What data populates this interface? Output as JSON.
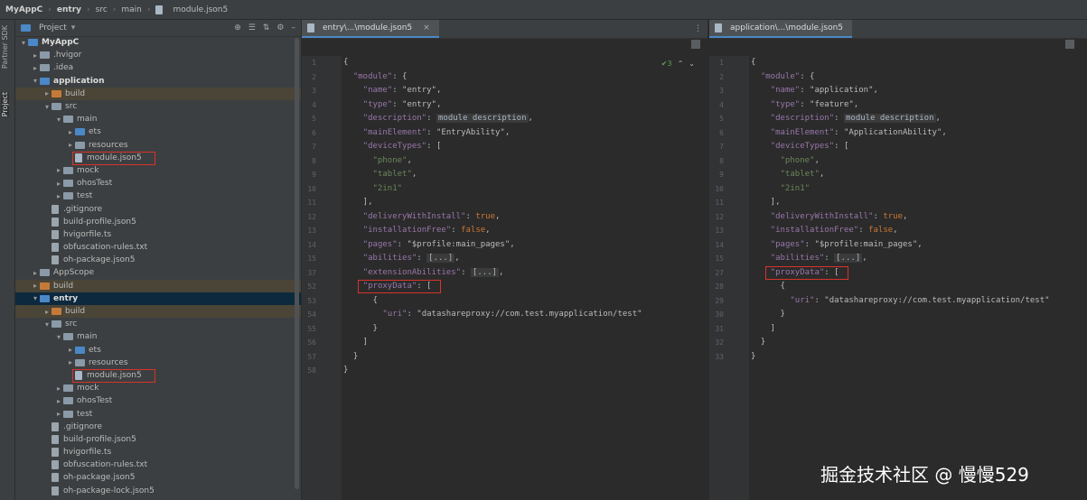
{
  "breadcrumb": [
    "MyAppC",
    "entry",
    "src",
    "main",
    "module.json5"
  ],
  "side_tools": [
    "Partner SDK",
    "Project"
  ],
  "project_panel": {
    "title": "Project"
  },
  "tree": [
    {
      "label": "MyAppC",
      "depth": 0,
      "type": "folder-blue",
      "expanded": true,
      "bold": true
    },
    {
      "label": ".hvigor",
      "depth": 1,
      "type": "folder",
      "collapsed": true
    },
    {
      "label": ".idea",
      "depth": 1,
      "type": "folder",
      "collapsed": true
    },
    {
      "label": "application",
      "depth": 1,
      "type": "folder-blue",
      "expanded": true,
      "bold": true
    },
    {
      "label": "build",
      "depth": 2,
      "type": "folder-orange",
      "collapsed": true,
      "hl": "yellow"
    },
    {
      "label": "src",
      "depth": 2,
      "type": "folder",
      "expanded": true
    },
    {
      "label": "main",
      "depth": 3,
      "type": "folder",
      "expanded": true
    },
    {
      "label": "ets",
      "depth": 4,
      "type": "folder-blue",
      "collapsed": true
    },
    {
      "label": "resources",
      "depth": 4,
      "type": "folder",
      "collapsed": true
    },
    {
      "label": "module.json5",
      "depth": 4,
      "type": "json",
      "boxed": true
    },
    {
      "label": "mock",
      "depth": 3,
      "type": "folder",
      "collapsed": true
    },
    {
      "label": "ohosTest",
      "depth": 3,
      "type": "folder",
      "collapsed": true
    },
    {
      "label": "test",
      "depth": 3,
      "type": "folder",
      "collapsed": true
    },
    {
      "label": ".gitignore",
      "depth": 2,
      "type": "file"
    },
    {
      "label": "build-profile.json5",
      "depth": 2,
      "type": "file"
    },
    {
      "label": "hvigorfile.ts",
      "depth": 2,
      "type": "file"
    },
    {
      "label": "obfuscation-rules.txt",
      "depth": 2,
      "type": "file"
    },
    {
      "label": "oh-package.json5",
      "depth": 2,
      "type": "file"
    },
    {
      "label": "AppScope",
      "depth": 1,
      "type": "folder",
      "collapsed": true
    },
    {
      "label": "build",
      "depth": 1,
      "type": "folder-orange",
      "collapsed": true,
      "hl": "yellow"
    },
    {
      "label": "entry",
      "depth": 1,
      "type": "folder-blue",
      "expanded": true,
      "bold": true,
      "hl": "blue"
    },
    {
      "label": "build",
      "depth": 2,
      "type": "folder-orange",
      "collapsed": true,
      "hl": "yellow"
    },
    {
      "label": "src",
      "depth": 2,
      "type": "folder",
      "expanded": true
    },
    {
      "label": "main",
      "depth": 3,
      "type": "folder",
      "expanded": true
    },
    {
      "label": "ets",
      "depth": 4,
      "type": "folder-blue",
      "collapsed": true
    },
    {
      "label": "resources",
      "depth": 4,
      "type": "folder",
      "collapsed": true
    },
    {
      "label": "module.json5",
      "depth": 4,
      "type": "json",
      "boxed": true
    },
    {
      "label": "mock",
      "depth": 3,
      "type": "folder",
      "collapsed": true
    },
    {
      "label": "ohosTest",
      "depth": 3,
      "type": "folder",
      "collapsed": true
    },
    {
      "label": "test",
      "depth": 3,
      "type": "folder",
      "collapsed": true
    },
    {
      "label": ".gitignore",
      "depth": 2,
      "type": "file"
    },
    {
      "label": "build-profile.json5",
      "depth": 2,
      "type": "file"
    },
    {
      "label": "hvigorfile.ts",
      "depth": 2,
      "type": "file"
    },
    {
      "label": "obfuscation-rules.txt",
      "depth": 2,
      "type": "file"
    },
    {
      "label": "oh-package.json5",
      "depth": 2,
      "type": "file"
    },
    {
      "label": "oh-package-lock.json5",
      "depth": 2,
      "type": "file"
    }
  ],
  "left_editor": {
    "tab": "entry\\...\\module.json5",
    "status": "✔3",
    "lines": [
      {
        "n": "1",
        "t": "{"
      },
      {
        "n": "2",
        "t": "  \"module\": {"
      },
      {
        "n": "3",
        "t": "    \"name\": \"entry\","
      },
      {
        "n": "4",
        "t": "    \"type\": \"entry\","
      },
      {
        "n": "5",
        "t": "    \"description\": module description,"
      },
      {
        "n": "6",
        "t": "    \"mainElement\": \"EntryAbility\","
      },
      {
        "n": "7",
        "t": "    \"deviceTypes\": ["
      },
      {
        "n": "8",
        "t": "      \"phone\","
      },
      {
        "n": "9",
        "t": "      \"tablet\","
      },
      {
        "n": "10",
        "t": "      \"2in1\""
      },
      {
        "n": "11",
        "t": "    ],"
      },
      {
        "n": "12",
        "t": "    \"deliveryWithInstall\": true,"
      },
      {
        "n": "13",
        "t": "    \"installationFree\": false,"
      },
      {
        "n": "14",
        "t": "    \"pages\": \"$profile:main_pages\","
      },
      {
        "n": "15",
        "t": "    \"abilities\": [...],"
      },
      {
        "n": "37",
        "t": "    \"extensionAbilities\": [...],"
      },
      {
        "n": "52",
        "t": "    \"proxyData\": ["
      },
      {
        "n": "53",
        "t": "      {"
      },
      {
        "n": "54",
        "t": "        \"uri\": \"datashareproxy://com.test.myapplication/test\""
      },
      {
        "n": "55",
        "t": "      }"
      },
      {
        "n": "56",
        "t": "    ]"
      },
      {
        "n": "57",
        "t": "  }"
      },
      {
        "n": "58",
        "t": "}"
      }
    ]
  },
  "right_editor": {
    "tab": "application\\...\\module.json5",
    "lines": [
      {
        "n": "1",
        "t": "{"
      },
      {
        "n": "2",
        "t": "  \"module\": {"
      },
      {
        "n": "3",
        "t": "    \"name\": \"application\","
      },
      {
        "n": "4",
        "t": "    \"type\": \"feature\","
      },
      {
        "n": "5",
        "t": "    \"description\": module description,"
      },
      {
        "n": "6",
        "t": "    \"mainElement\": \"ApplicationAbility\","
      },
      {
        "n": "7",
        "t": "    \"deviceTypes\": ["
      },
      {
        "n": "8",
        "t": "      \"phone\","
      },
      {
        "n": "9",
        "t": "      \"tablet\","
      },
      {
        "n": "10",
        "t": "      \"2in1\""
      },
      {
        "n": "11",
        "t": "    ],"
      },
      {
        "n": "12",
        "t": "    \"deliveryWithInstall\": true,"
      },
      {
        "n": "13",
        "t": "    \"installationFree\": false,"
      },
      {
        "n": "14",
        "t": "    \"pages\": \"$profile:main_pages\","
      },
      {
        "n": "15",
        "t": "    \"abilities\": [...],"
      },
      {
        "n": "27",
        "t": "    \"proxyData\": ["
      },
      {
        "n": "28",
        "t": "      {"
      },
      {
        "n": "29",
        "t": "        \"uri\": \"datashareproxy://com.test.myapplication/test\""
      },
      {
        "n": "30",
        "t": "      }"
      },
      {
        "n": "31",
        "t": "    ]"
      },
      {
        "n": "32",
        "t": "  }"
      },
      {
        "n": "33",
        "t": "}"
      }
    ]
  },
  "watermark": "掘金技术社区 @ 慢慢529"
}
